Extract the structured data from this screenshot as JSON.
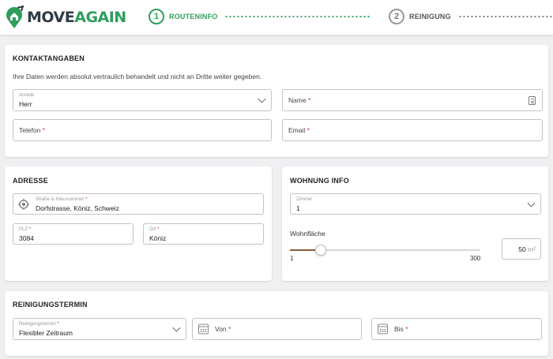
{
  "brand": {
    "move": "MOVE",
    "again": "AGAIN"
  },
  "steps": [
    {
      "number": "1",
      "label": "ROUTENINFO"
    },
    {
      "number": "2",
      "label": "REINIGUNG"
    }
  ],
  "contact": {
    "title": "KONTAKTANGABEN",
    "notice": "Ihre Daten werden absolut vertraulich behandelt und nicht an Dritte weiter gegeben.",
    "salutation_label": "Anrede",
    "salutation_value": "Herr",
    "name_placeholder": "Name",
    "phone_placeholder": "Telefon",
    "email_placeholder": "Email"
  },
  "address": {
    "title": "ADRESSE",
    "street_label": "Straße & Hausnummer",
    "street_value": "Dorfstrasse, Köniz, Schweiz",
    "zip_label": "PLZ",
    "zip_value": "3084",
    "city_label": "Ort",
    "city_value": "Köniz"
  },
  "apartment": {
    "title": "WOHNUNG INFO",
    "rooms_label": "Zimmer",
    "rooms_value": "1",
    "area_label": "Wohnfläche",
    "slider_min": "1",
    "slider_max": "300",
    "slider_value": 50,
    "area_value": "50",
    "area_unit": "m²"
  },
  "cleaning": {
    "title": "REINIGUNGSTERMIN",
    "date_label": "Reinigungstermin",
    "date_value": "Flexibler Zeitraum",
    "from_placeholder": "Von",
    "to_placeholder": "Bis"
  },
  "required_marker": "*",
  "colors": {
    "accent": "#2e9e5b",
    "required": "#d32f2f",
    "slider": "#8b5a3c"
  }
}
